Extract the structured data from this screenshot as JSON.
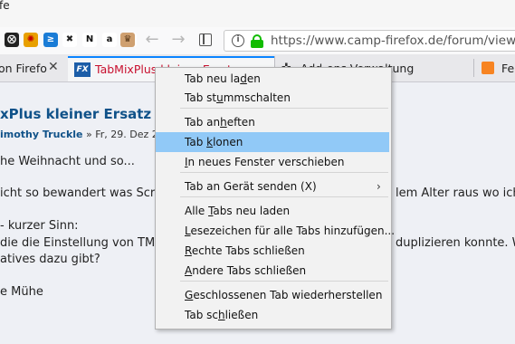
{
  "window": {
    "title_fragment": "fe"
  },
  "toolbar": {
    "extensions": [
      {
        "name": "extension-icon-1",
        "glyph": "⨂",
        "bg": "#222222",
        "fg": "#ffffff"
      },
      {
        "name": "extension-icon-2",
        "glyph": "✺",
        "bg": "#e8a000",
        "fg": "#c40000"
      },
      {
        "name": "extension-icon-3",
        "glyph": "≥",
        "bg": "#1a7cd6",
        "fg": "#ffffff"
      },
      {
        "name": "extension-icon-4",
        "glyph": "✖",
        "bg": "#ffffff",
        "fg": "#222222"
      },
      {
        "name": "extension-icon-5",
        "glyph": "N",
        "bg": "#ffffff",
        "fg": "#111111"
      },
      {
        "name": "amazon-icon",
        "glyph": "a",
        "bg": "#ffffff",
        "fg": "#111111"
      },
      {
        "name": "vodafone-icon",
        "glyph": "◯",
        "bg": "#ffffff",
        "fg": "#e60000"
      },
      {
        "name": "extension-icon-8",
        "glyph": "♛",
        "bg": "#cfa070",
        "fg": "#5a3a1a"
      }
    ],
    "url": "https://www.camp-firefox.de/forum/viewtopi"
  },
  "tabs": [
    {
      "label": "on Firefo"
    },
    {
      "label": "TabMixPlus kleiner Ersatz",
      "favicon": "FX"
    },
    {
      "label": "Add-ons-Verwaltung"
    },
    {
      "label": "Fe"
    }
  ],
  "post": {
    "title": "xPlus kleiner Ersatz",
    "author": "imothy Truckle",
    "meta": " » Fr, 29. Dez 2",
    "lines": [
      "he Weihnacht und so...",
      "icht so bewandert was Script",
      "- kurzer Sinn:",
      " die die Einstellung von TMP-",
      "atives dazu gibt?",
      "e Mühe"
    ],
    "line_right_1": "lem Alter raus wo ich m",
    "line_right_2": "duplizieren konnte. Wei"
  },
  "context_menu": {
    "items": [
      {
        "label": "Tab neu laden",
        "mnemonic_index": 10
      },
      {
        "label": "Tab stummschalten",
        "mnemonic_index": 6
      },
      {
        "label": "Tab anheften",
        "mnemonic_index": 6
      },
      {
        "label": "Tab klonen",
        "highlighted": true,
        "mnemonic_index": 4
      },
      {
        "label": "In neues Fenster verschieben",
        "mnemonic_index": 0
      },
      {
        "label": "Tab an Gerät senden (X)",
        "submenu": true
      },
      {
        "label": "Alle Tabs neu laden",
        "mnemonic_index": 5
      },
      {
        "label": "Lesezeichen für alle Tabs hinzufügen...",
        "mnemonic_index": 0
      },
      {
        "label": "Rechte Tabs schließen",
        "mnemonic_index": 0
      },
      {
        "label": "Andere Tabs schließen",
        "mnemonic_index": 0
      },
      {
        "label": "Geschlossenen Tab wiederherstellen",
        "mnemonic_index": 0
      },
      {
        "label": "Tab schließen",
        "mnemonic_index": 6
      }
    ]
  },
  "colors": {
    "accent": "#0a84ff",
    "highlight": "#91c9f7",
    "link": "#105289",
    "secure_lock": "#12bc00"
  }
}
